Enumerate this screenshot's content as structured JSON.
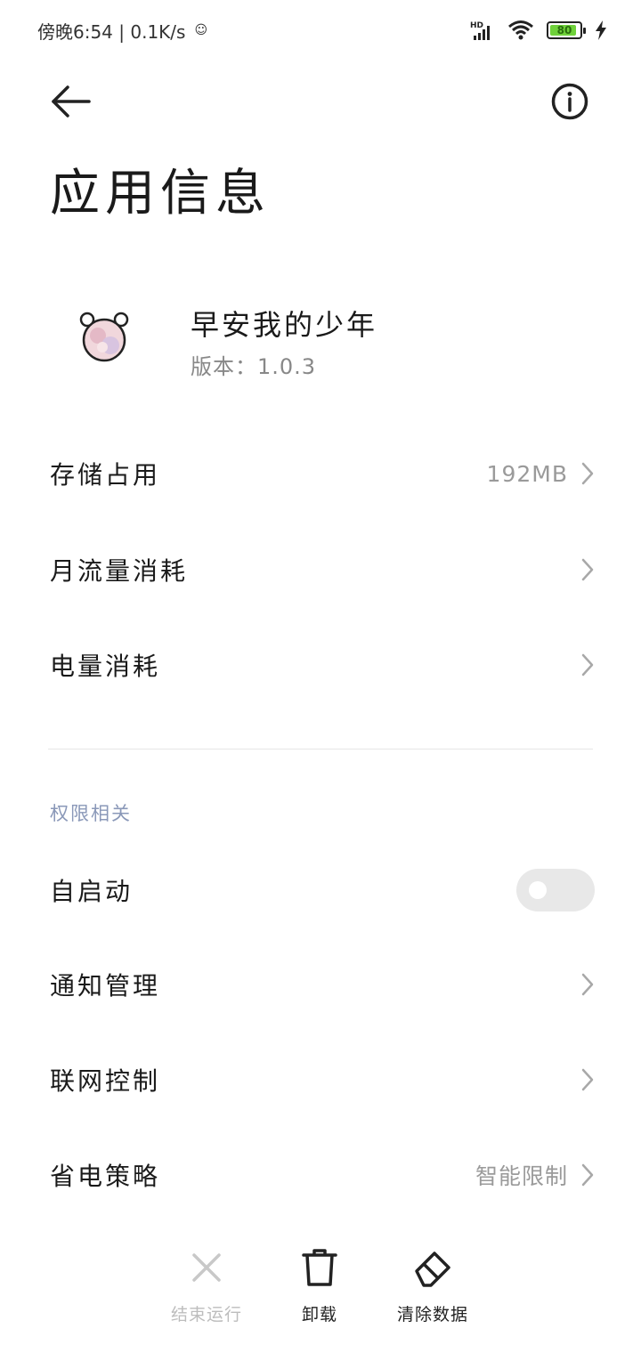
{
  "status_bar": {
    "left_text": "傍晚6:54 | 0.1K/s",
    "signal_label": "HD",
    "battery_level": "80"
  },
  "header": {
    "title": "应用信息"
  },
  "app": {
    "name": "早安我的少年",
    "version": "版本：1.0.3"
  },
  "rows": {
    "storage": {
      "label": "存储占用",
      "value": "192MB"
    },
    "data_usage": {
      "label": "月流量消耗"
    },
    "battery_usage": {
      "label": "电量消耗"
    }
  },
  "permissions": {
    "section_title": "权限相关",
    "autostart": {
      "label": "自启动",
      "enabled": false
    },
    "notifications": {
      "label": "通知管理"
    },
    "network": {
      "label": "联网控制"
    },
    "power_saving": {
      "label": "省电策略",
      "value": "智能限制"
    }
  },
  "bottom_actions": {
    "force_stop": {
      "label": "结束运行",
      "enabled": false
    },
    "uninstall": {
      "label": "卸载"
    },
    "clear_data": {
      "label": "清除数据"
    }
  }
}
